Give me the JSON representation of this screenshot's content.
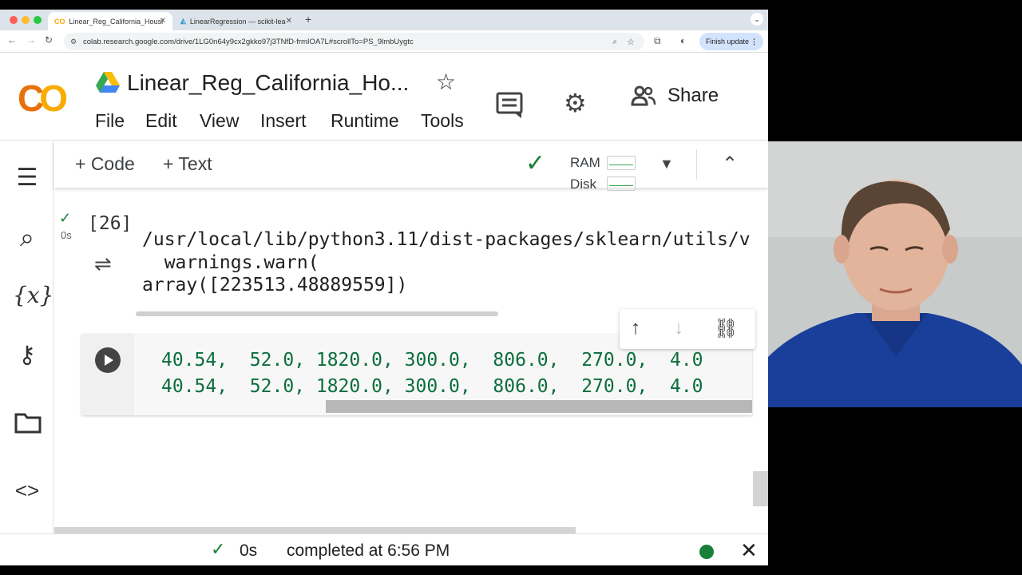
{
  "browser": {
    "tabs": [
      {
        "label": "Linear_Reg_California_Housi",
        "favicon": "CO"
      },
      {
        "label": "LinearRegression — scikit-lea",
        "favicon": "sklearn"
      }
    ],
    "new_tab": "+",
    "url": "colab.research.google.com/drive/1LG0n64y9cx2gkko97j3TNfD-frmIOA7L#scrollTo=PS_9lmbUygtc",
    "finish_update": "Finish update"
  },
  "colab": {
    "logo": "CO",
    "notebook_title": "Linear_Reg_California_Ho...",
    "menu": [
      "File",
      "Edit",
      "View",
      "Insert",
      "Runtime",
      "Tools"
    ],
    "share_label": "Share"
  },
  "cell_toolbar": {
    "add_code": "+ Code",
    "add_text": "+ Text",
    "ram_label": "RAM",
    "disk_label": "Disk"
  },
  "output_cell": {
    "exec_count": "[26]",
    "run_time": "0s",
    "lines": [
      "/usr/local/lib/python3.11/dist-packages/sklearn/utils/v",
      "  warnings.warn(",
      "array([223513.48889559])"
    ]
  },
  "code_cell": {
    "lines": [
      "40.54,  52.0, 1820.0, 300.0,  806.0,  270.0,  4.0",
      "40.54,  52.0, 1820.0, 300.0,  806.0,  270.0,  4.0"
    ]
  },
  "statusbar": {
    "time": "0s",
    "message": "completed at 6:56 PM"
  },
  "icons": {
    "sidebar": [
      "toc-icon",
      "search-icon",
      "variables-icon",
      "key-icon",
      "folder-icon",
      "code-snippets-icon"
    ],
    "header": [
      "comment-icon",
      "gear-icon",
      "share-people-icon"
    ]
  },
  "colors": {
    "accent_green": "#188038",
    "code_green": "#0b6e3c",
    "logo_orange": "#f9ab00"
  }
}
